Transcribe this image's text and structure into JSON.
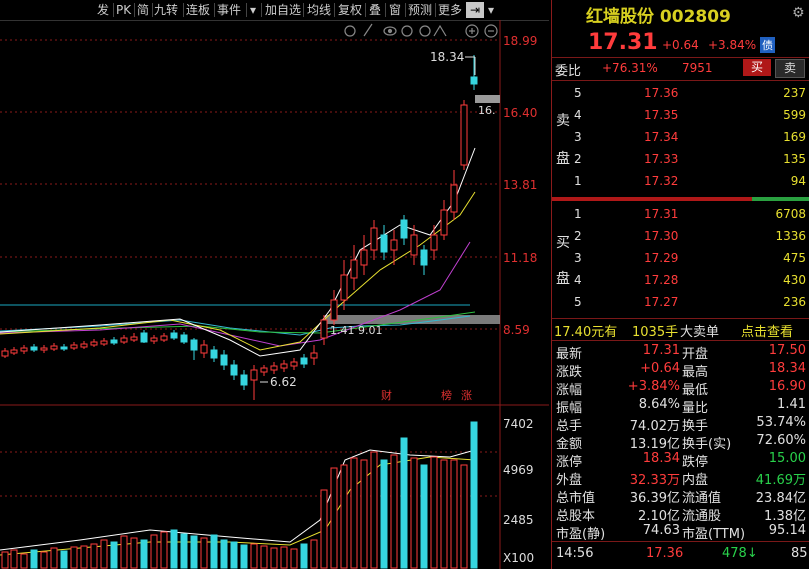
{
  "toolbar": {
    "items": [
      "发",
      "PK",
      "简",
      "九转",
      "连板",
      "事件",
      "▾",
      "加自选",
      "均线",
      "复权",
      "叠",
      "窗",
      "预测",
      "更多",
      "⇥",
      "▾"
    ]
  },
  "chart": {
    "price_axis": [
      "18.99",
      "16.40",
      "13.81",
      "11.18",
      "8.59"
    ],
    "volume_axis": [
      "7402",
      "4969",
      "2485",
      "X100"
    ],
    "high_label": "18.34",
    "low_label": "6.62",
    "current_tag": "16.",
    "ma_hint": "1.41  9.01",
    "markers": [
      "财",
      "榜",
      "涨"
    ]
  },
  "header": {
    "name": "红墙股份 002809",
    "price": "17.31",
    "change": "+0.64",
    "change_pct": "+3.84%",
    "badge": "债"
  },
  "weibi": {
    "label": "委比",
    "pct": "+76.31%",
    "diff": "7951",
    "buy": "买",
    "sell": "卖"
  },
  "asks_side_label": [
    "卖",
    "盘"
  ],
  "bids_side_label": [
    "买",
    "盘"
  ],
  "asks": [
    {
      "level": "5",
      "price": "17.36",
      "volume": "237"
    },
    {
      "level": "4",
      "price": "17.35",
      "volume": "599"
    },
    {
      "level": "3",
      "price": "17.34",
      "volume": "169"
    },
    {
      "level": "2",
      "price": "17.33",
      "volume": "135"
    },
    {
      "level": "1",
      "price": "17.32",
      "volume": "94"
    }
  ],
  "bids": [
    {
      "level": "1",
      "price": "17.31",
      "volume": "6708"
    },
    {
      "level": "2",
      "price": "17.30",
      "volume": "1336"
    },
    {
      "level": "3",
      "price": "17.29",
      "volume": "475"
    },
    {
      "level": "4",
      "price": "17.28",
      "volume": "430"
    },
    {
      "level": "5",
      "price": "17.27",
      "volume": "236"
    }
  ],
  "bigorder": {
    "text1": "17.40元有",
    "text2": "1035手",
    "text3": "大卖单",
    "link": "点击查看"
  },
  "quotes": [
    {
      "l1": "最新",
      "v1": "17.31",
      "c1": "red",
      "l2": "开盘",
      "v2": "17.50",
      "c2": "red"
    },
    {
      "l1": "涨跌",
      "v1": "+0.64",
      "c1": "red",
      "l2": "最高",
      "v2": "18.34",
      "c2": "red"
    },
    {
      "l1": "涨幅",
      "v1": "+3.84%",
      "c1": "red",
      "l2": "最低",
      "v2": "16.90",
      "c2": "red"
    },
    {
      "l1": "振幅",
      "v1": "8.64%",
      "c1": "white",
      "l2": "量比",
      "v2": "1.41",
      "c2": "white"
    },
    {
      "l1": "总手",
      "v1": "74.02万",
      "c1": "white",
      "l2": "换手",
      "v2": "53.74%",
      "c2": "white"
    },
    {
      "l1": "金额",
      "v1": "13.19亿",
      "c1": "white",
      "l2": "换手(实)",
      "v2": "72.60%",
      "c2": "white"
    },
    {
      "l1": "涨停",
      "v1": "18.34",
      "c1": "red",
      "l2": "跌停",
      "v2": "15.00",
      "c2": "green"
    },
    {
      "l1": "外盘",
      "v1": "32.33万",
      "c1": "red",
      "l2": "内盘",
      "v2": "41.69万",
      "c2": "green"
    },
    {
      "l1": "总市值",
      "v1": "36.39亿",
      "c1": "white",
      "l2": "流通值",
      "v2": "23.84亿",
      "c2": "white"
    },
    {
      "l1": "总股本",
      "v1": "2.10亿",
      "c1": "white",
      "l2": "流通股",
      "v2": "1.38亿",
      "c2": "white"
    },
    {
      "l1": "市盈(静)",
      "v1": "74.63",
      "c1": "white",
      "l2": "市盈(TTM)",
      "v2": "95.14",
      "c2": "white"
    }
  ],
  "tick": {
    "time": "14:56",
    "price": "17.36",
    "volume": "478",
    "count": "85"
  },
  "colors": {
    "up": "#ff3c3c",
    "down": "#36d6e0",
    "accent": "#d8d020"
  }
}
